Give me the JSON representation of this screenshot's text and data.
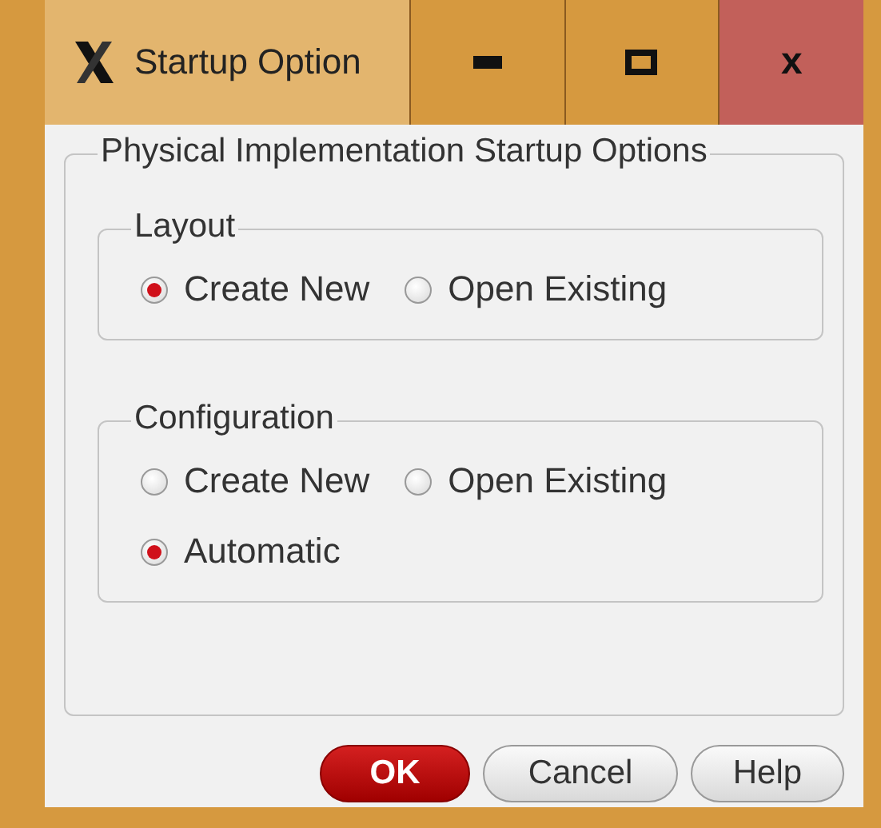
{
  "window": {
    "title": "Startup Option",
    "close": "x"
  },
  "group": {
    "title": "Physical Implementation Startup Options",
    "sections": [
      {
        "title": "Layout",
        "options": [
          {
            "label": "Create New",
            "selected": true
          },
          {
            "label": "Open Existing",
            "selected": false
          }
        ]
      },
      {
        "title": "Configuration",
        "options": [
          {
            "label": "Create New",
            "selected": false
          },
          {
            "label": "Open Existing",
            "selected": false
          },
          {
            "label": "Automatic",
            "selected": true
          }
        ]
      }
    ]
  },
  "buttons": [
    {
      "label": "OK",
      "kind": "default"
    },
    {
      "label": "Cancel",
      "kind": "normal"
    },
    {
      "label": "Help",
      "kind": "normal"
    }
  ]
}
